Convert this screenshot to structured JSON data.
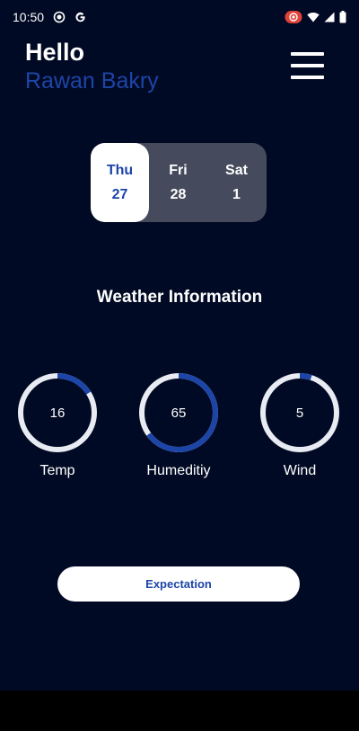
{
  "status_bar": {
    "time": "10:50",
    "icons_left": [
      "record-icon",
      "google-icon"
    ],
    "icons_right": [
      "camera-badge-icon",
      "wifi-icon",
      "signal-icon",
      "battery-icon"
    ]
  },
  "header": {
    "greeting": "Hello",
    "user_name": "Rawan Bakry",
    "menu_icon": "hamburger-menu-icon"
  },
  "days": [
    {
      "name": "Thu",
      "date": "27",
      "selected": true
    },
    {
      "name": "Fri",
      "date": "28",
      "selected": false
    },
    {
      "name": "Sat",
      "date": "1",
      "selected": false
    }
  ],
  "weather": {
    "title": "Weather Information",
    "gauges": [
      {
        "label": "Temp",
        "value": "16",
        "progress": 0.16
      },
      {
        "label": "Humeditiy",
        "value": "65",
        "progress": 0.65
      },
      {
        "label": "Wind",
        "value": "5",
        "progress": 0.05
      }
    ]
  },
  "actions": {
    "expectation_label": "Expectation"
  },
  "colors": {
    "background": "#010a24",
    "accent": "#1d45a8",
    "track": "#e8ebf2",
    "day_selector_bg": "#454b5d"
  }
}
